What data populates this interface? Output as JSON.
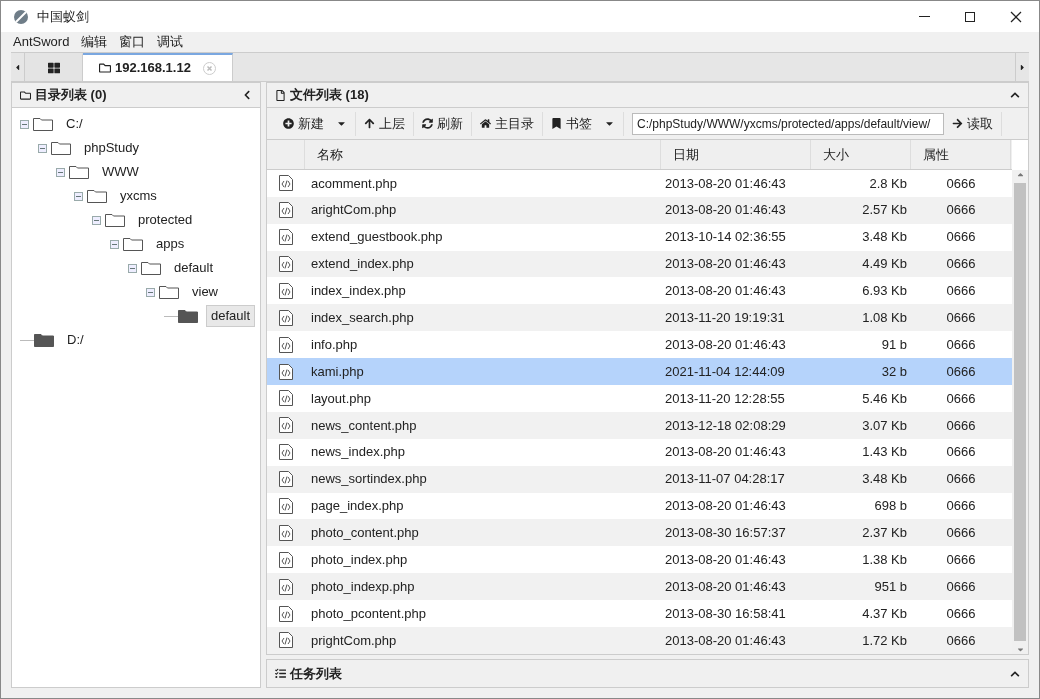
{
  "window": {
    "title": "中国蚁剑"
  },
  "menu": [
    "AntSword",
    "编辑",
    "窗口",
    "调试"
  ],
  "tabs": [
    {
      "kind": "home",
      "selected": false
    },
    {
      "kind": "shell",
      "label": "192.168.1.12",
      "selected": true
    }
  ],
  "dir_panel": {
    "title": "目录列表 (0)",
    "tree": [
      {
        "label": "C:/",
        "expanded": true,
        "selected": false,
        "children": [
          {
            "label": "phpStudy",
            "expanded": true,
            "selected": false,
            "children": [
              {
                "label": "WWW",
                "expanded": true,
                "selected": false,
                "children": [
                  {
                    "label": "yxcms",
                    "expanded": true,
                    "selected": false,
                    "children": [
                      {
                        "label": "protected",
                        "expanded": true,
                        "selected": false,
                        "children": [
                          {
                            "label": "apps",
                            "expanded": true,
                            "selected": false,
                            "children": [
                              {
                                "label": "default",
                                "expanded": true,
                                "selected": false,
                                "children": [
                                  {
                                    "label": "view",
                                    "expanded": true,
                                    "selected": false,
                                    "children": [
                                      {
                                        "label": "default",
                                        "expanded": false,
                                        "selected": true
                                      }
                                    ]
                                  }
                                ]
                              }
                            ]
                          }
                        ]
                      }
                    ]
                  }
                ]
              }
            ]
          }
        ]
      },
      {
        "label": "D:/",
        "expanded": false,
        "selected": false
      }
    ]
  },
  "file_panel": {
    "title": "文件列表 (18)",
    "toolbar": [
      {
        "kind": "new",
        "label": "新建",
        "dropdown": true
      },
      {
        "kind": "up",
        "label": "上层",
        "dropdown": false
      },
      {
        "kind": "refresh",
        "label": "刷新",
        "dropdown": false
      },
      {
        "kind": "home",
        "label": "主目录",
        "dropdown": false
      },
      {
        "kind": "bookmark",
        "label": "书签",
        "dropdown": true
      }
    ],
    "path": "C:/phpStudy/WWW/yxcms/protected/apps/default/view/",
    "read_button": "读取",
    "columns": [
      "名称",
      "日期",
      "大小",
      "属性"
    ],
    "rows": [
      {
        "name": "acomment.php",
        "date": "2013-08-20 01:46:43",
        "size": "2.8 Kb",
        "attr": "0666",
        "selected": false
      },
      {
        "name": "arightCom.php",
        "date": "2013-08-20 01:46:43",
        "size": "2.57 Kb",
        "attr": "0666",
        "selected": false
      },
      {
        "name": "extend_guestbook.php",
        "date": "2013-10-14 02:36:55",
        "size": "3.48 Kb",
        "attr": "0666",
        "selected": false
      },
      {
        "name": "extend_index.php",
        "date": "2013-08-20 01:46:43",
        "size": "4.49 Kb",
        "attr": "0666",
        "selected": false
      },
      {
        "name": "index_index.php",
        "date": "2013-08-20 01:46:43",
        "size": "6.93 Kb",
        "attr": "0666",
        "selected": false
      },
      {
        "name": "index_search.php",
        "date": "2013-11-20 19:19:31",
        "size": "1.08 Kb",
        "attr": "0666",
        "selected": false
      },
      {
        "name": "info.php",
        "date": "2013-08-20 01:46:43",
        "size": "91 b",
        "attr": "0666",
        "selected": false
      },
      {
        "name": "kami.php",
        "date": "2021-11-04 12:44:09",
        "size": "32 b",
        "attr": "0666",
        "selected": true
      },
      {
        "name": "layout.php",
        "date": "2013-11-20 12:28:55",
        "size": "5.46 Kb",
        "attr": "0666",
        "selected": false
      },
      {
        "name": "news_content.php",
        "date": "2013-12-18 02:08:29",
        "size": "3.07 Kb",
        "attr": "0666",
        "selected": false
      },
      {
        "name": "news_index.php",
        "date": "2013-08-20 01:46:43",
        "size": "1.43 Kb",
        "attr": "0666",
        "selected": false
      },
      {
        "name": "news_sortindex.php",
        "date": "2013-11-07 04:28:17",
        "size": "3.48 Kb",
        "attr": "0666",
        "selected": false
      },
      {
        "name": "page_index.php",
        "date": "2013-08-20 01:46:43",
        "size": "698 b",
        "attr": "0666",
        "selected": false
      },
      {
        "name": "photo_content.php",
        "date": "2013-08-30 16:57:37",
        "size": "2.37 Kb",
        "attr": "0666",
        "selected": false
      },
      {
        "name": "photo_index.php",
        "date": "2013-08-20 01:46:43",
        "size": "1.38 Kb",
        "attr": "0666",
        "selected": false
      },
      {
        "name": "photo_indexp.php",
        "date": "2013-08-20 01:46:43",
        "size": "951 b",
        "attr": "0666",
        "selected": false
      },
      {
        "name": "photo_pcontent.php",
        "date": "2013-08-30 16:58:41",
        "size": "4.37 Kb",
        "attr": "0666",
        "selected": false
      },
      {
        "name": "prightCom.php",
        "date": "2013-08-20 01:46:43",
        "size": "1.72 Kb",
        "attr": "0666",
        "selected": false
      }
    ]
  },
  "task_panel": {
    "title": "任务列表"
  }
}
